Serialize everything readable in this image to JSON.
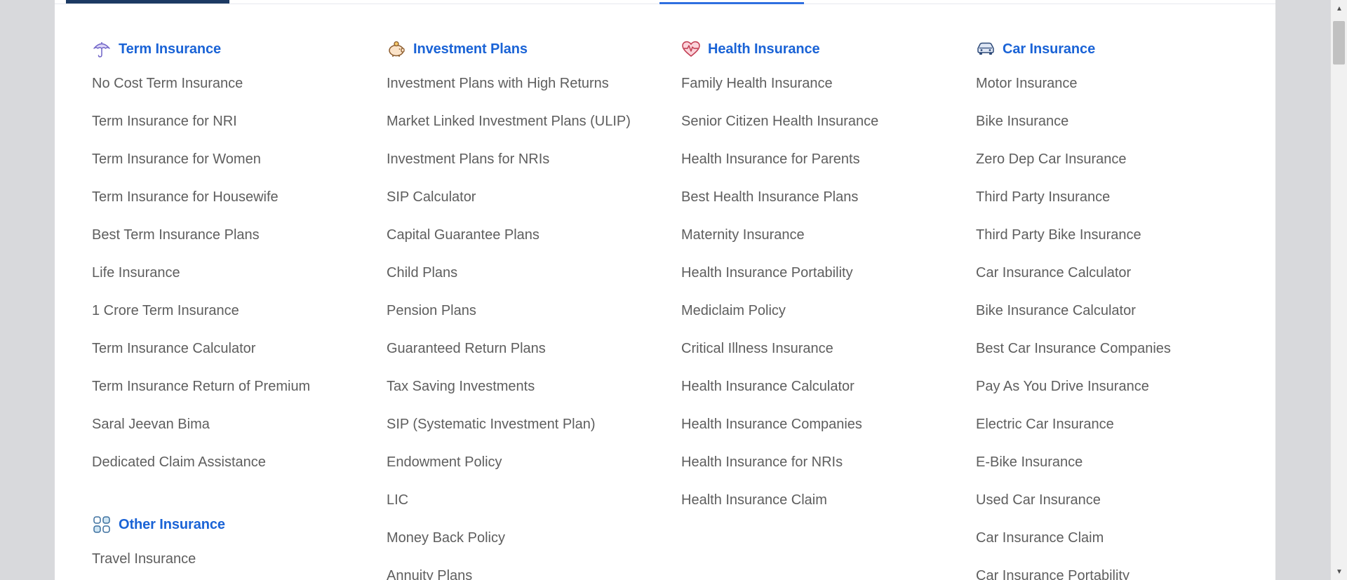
{
  "columns": [
    {
      "title": "Term Insurance",
      "icon": "umbrella-icon",
      "items": [
        "No Cost Term Insurance",
        "Term Insurance for NRI",
        "Term Insurance for Women",
        "Term Insurance for Housewife",
        "Best Term Insurance Plans",
        "Life Insurance",
        "1 Crore Term Insurance",
        "Term Insurance Calculator",
        "Term Insurance Return of Premium",
        "Saral Jeevan Bima",
        "Dedicated Claim Assistance"
      ],
      "extra_section": {
        "title": "Other Insurance",
        "icon": "grid-icon",
        "items": [
          "Travel Insurance"
        ]
      }
    },
    {
      "title": "Investment Plans",
      "icon": "piggy-bank-icon",
      "items": [
        "Investment Plans with High Returns",
        "Market Linked Investment Plans (ULIP)",
        "Investment Plans for NRIs",
        "SIP Calculator",
        "Capital Guarantee Plans",
        "Child Plans",
        "Pension Plans",
        "Guaranteed Return Plans",
        "Tax Saving Investments",
        "SIP (Systematic Investment Plan)",
        "Endowment Policy",
        "LIC",
        "Money Back Policy",
        "Annuity Plans"
      ]
    },
    {
      "title": "Health Insurance",
      "icon": "heartbeat-icon",
      "items": [
        "Family Health Insurance",
        "Senior Citizen Health Insurance",
        "Health Insurance for Parents",
        "Best Health Insurance Plans",
        "Maternity Insurance",
        "Health Insurance Portability",
        "Mediclaim Policy",
        "Critical Illness Insurance",
        "Health Insurance Calculator",
        "Health Insurance Companies",
        "Health Insurance for NRIs",
        "Health Insurance Claim"
      ]
    },
    {
      "title": "Car Insurance",
      "icon": "car-icon",
      "items": [
        "Motor Insurance",
        "Bike Insurance",
        "Zero Dep Car Insurance",
        "Third Party Insurance",
        "Third Party Bike Insurance",
        "Car Insurance Calculator",
        "Bike Insurance Calculator",
        "Best Car Insurance Companies",
        "Pay As You Drive Insurance",
        "Electric Car Insurance",
        "E-Bike Insurance",
        "Used Car Insurance",
        "Car Insurance Claim",
        "Car Insurance Portability"
      ]
    }
  ],
  "colors": {
    "accent": "#1a63d6",
    "link_text": "#5e5e5e",
    "tab_dark": "#1c3a63",
    "tab_blue": "#2f6fe0"
  }
}
